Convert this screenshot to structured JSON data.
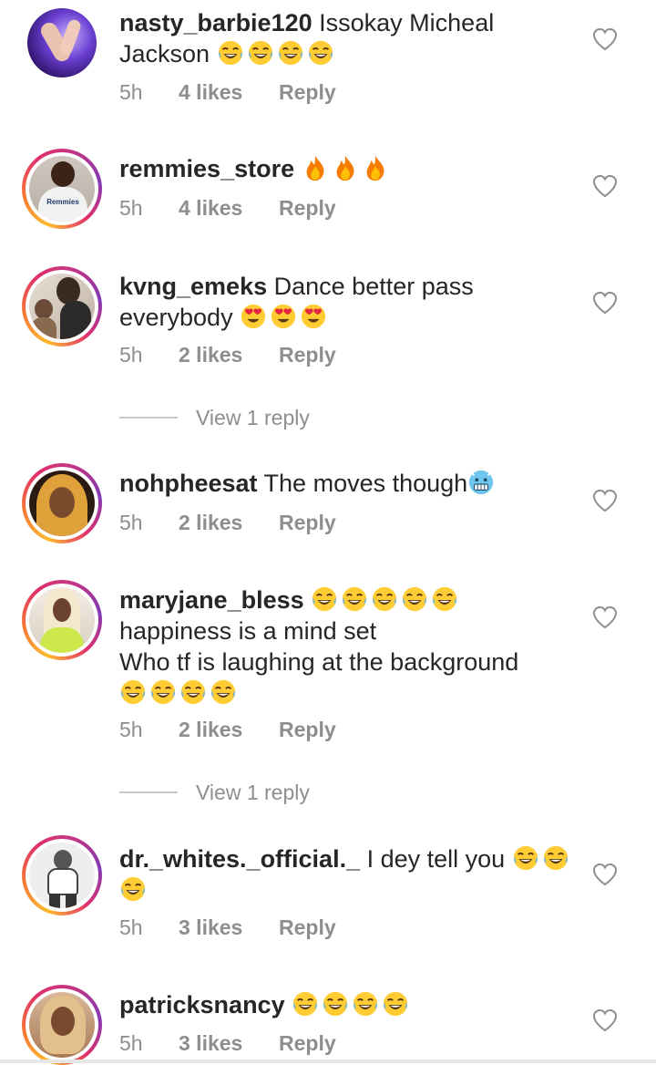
{
  "comments": [
    {
      "username": "nasty_barbie120",
      "text_lines": [
        "Issokay Micheal",
        "Jackson"
      ],
      "emoji_after": [
        "laugh",
        "laugh",
        "laugh",
        "laugh"
      ],
      "time": "5h",
      "likes": "4 likes",
      "reply": "Reply",
      "avatar_story_ring": false,
      "avatar_desc": "hand with blue nails"
    },
    {
      "username": "remmies_store",
      "text_lines": [
        ""
      ],
      "emoji_after": [
        "fire",
        "fire",
        "fire"
      ],
      "time": "5h",
      "likes": "4 likes",
      "reply": "Reply",
      "avatar_story_ring": true,
      "avatar_shirt_text": "Remmies"
    },
    {
      "username": "kvng_emeks",
      "text_lines": [
        "Dance better pass",
        "everybody"
      ],
      "emoji_after": [
        "heart-eyes",
        "heart-eyes",
        "heart-eyes"
      ],
      "time": "5h",
      "likes": "2 likes",
      "reply": "Reply",
      "avatar_story_ring": true
    },
    {
      "username": "nohpheesat",
      "text_lines": [
        "The moves though"
      ],
      "emoji_after": [
        "cold-face"
      ],
      "time": "5h",
      "likes": "2 likes",
      "reply": "Reply",
      "avatar_story_ring": true
    },
    {
      "username": "maryjane_bless",
      "text_lines": [
        "",
        "happiness is a mind set",
        "Who tf is laughing at the background",
        ""
      ],
      "emoji_first_line": [
        "laugh",
        "laugh",
        "laugh",
        "laugh",
        "laugh"
      ],
      "emoji_after": [
        "laugh",
        "laugh",
        "laugh",
        "laugh"
      ],
      "time": "5h",
      "likes": "2 likes",
      "reply": "Reply",
      "avatar_story_ring": true
    },
    {
      "username": "dr._whites._official._",
      "text_lines": [
        "I dey tell you"
      ],
      "emoji_after": [
        "laugh",
        "laugh",
        "laugh"
      ],
      "time": "5h",
      "likes": "3 likes",
      "reply": "Reply",
      "avatar_story_ring": true
    },
    {
      "username": "patricksnancy",
      "text_lines": [
        ""
      ],
      "emoji_after": [
        "laugh",
        "laugh",
        "laugh",
        "laugh"
      ],
      "time": "5h",
      "likes": "3 likes",
      "reply": "Reply",
      "avatar_story_ring": true
    }
  ],
  "view_replies": [
    "View 1 reply",
    "View 1 reply"
  ],
  "colors": {
    "text": "#262626",
    "meta": "#8e8e8e",
    "ring_start": "#fdbb2d",
    "ring_end": "#833ab4"
  }
}
